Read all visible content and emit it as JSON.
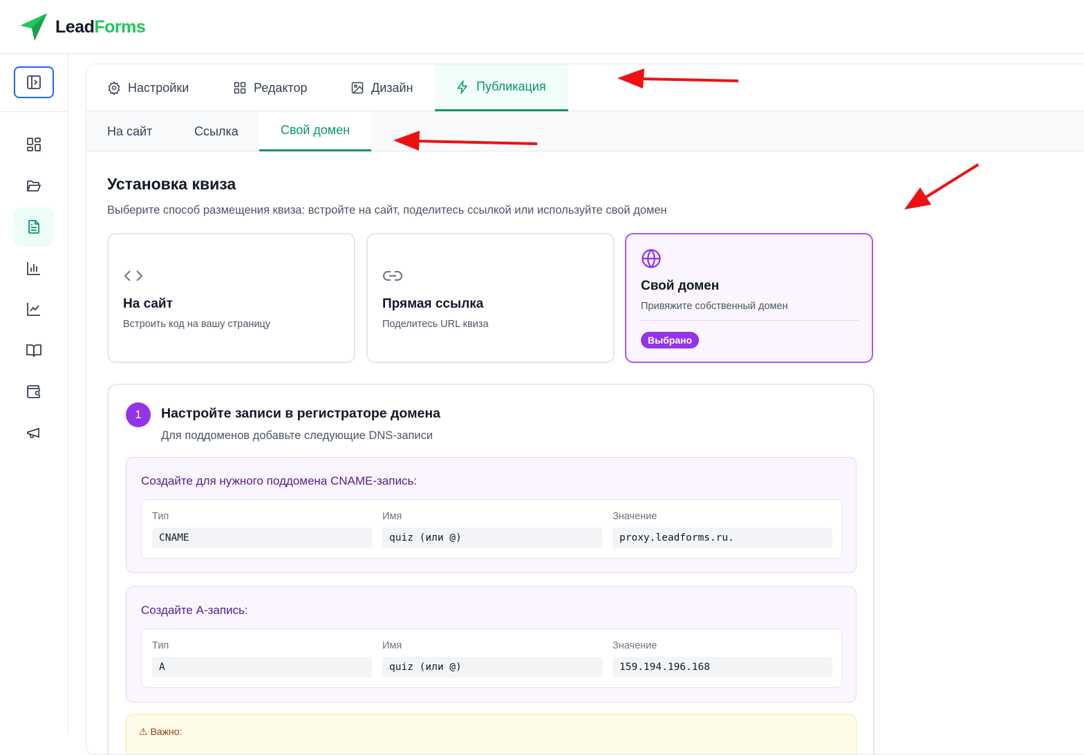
{
  "app": {
    "logo_lead": "Lead",
    "logo_forms": "Forms"
  },
  "sidebar": {
    "items": [
      {
        "icon": "dashboard-icon"
      },
      {
        "icon": "folder-icon"
      },
      {
        "icon": "document-icon",
        "active": true
      },
      {
        "icon": "bar-chart-icon"
      },
      {
        "icon": "line-chart-icon"
      },
      {
        "icon": "book-icon"
      },
      {
        "icon": "wallet-icon"
      },
      {
        "icon": "megaphone-icon"
      }
    ]
  },
  "tabs": [
    {
      "label": "Настройки",
      "icon": "gear-icon"
    },
    {
      "label": "Редактор",
      "icon": "grid-icon"
    },
    {
      "label": "Дизайн",
      "icon": "image-icon"
    },
    {
      "label": "Публикация",
      "icon": "lightning-icon",
      "active": true
    }
  ],
  "subtabs": [
    {
      "label": "На сайт"
    },
    {
      "label": "Ссылка"
    },
    {
      "label": "Свой домен",
      "active": true
    }
  ],
  "install": {
    "title": "Установка квиза",
    "description": "Выберите способ размещения квиза: встройте на сайт, поделитесь ссылкой или используйте свой домен"
  },
  "cards": [
    {
      "title": "На сайт",
      "desc": "Встроить код на вашу страницу",
      "icon": "code-icon"
    },
    {
      "title": "Прямая ссылка",
      "desc": "Поделитесь URL квиза",
      "icon": "link-icon"
    },
    {
      "title": "Свой домен",
      "desc": "Привяжите собственный домен",
      "icon": "globe-icon",
      "badge": "Выбрано"
    }
  ],
  "step1": {
    "number": "1",
    "title": "Настройте записи в регистраторе домена",
    "desc": "Для поддоменов добавьте следующие DNS-записи",
    "records": [
      {
        "title": "Создайте для нужного поддомена CNAME-запись:",
        "type_label": "Тип",
        "type": "CNAME",
        "name_label": "Имя",
        "name": "quiz (или @)",
        "value_label": "Значение",
        "value": "proxy.leadforms.ru."
      },
      {
        "title": "Создайте A-запись:",
        "type_label": "Тип",
        "type": "A",
        "name_label": "Имя",
        "name": "quiz (или @)",
        "value_label": "Значение",
        "value": "159.194.196.168"
      }
    ],
    "warning": "⚠ Важно:"
  },
  "colors": {
    "accent": "#059669",
    "purple": "#9333ea",
    "brand_green": "#22c55e",
    "arrow": "#ee1111"
  }
}
